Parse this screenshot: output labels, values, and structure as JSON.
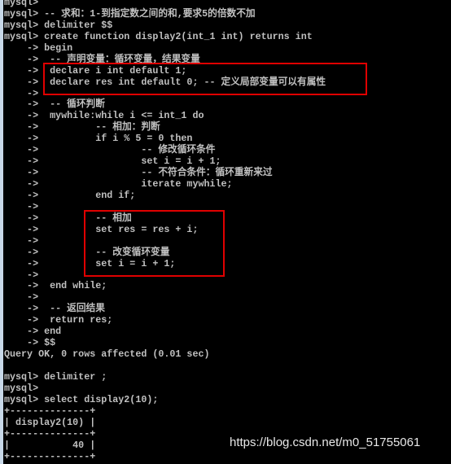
{
  "terminal": {
    "lines": [
      "mysql>",
      "mysql> -- 求和：1-到指定数之间的和,要求5的倍数不加",
      "mysql> delimiter $$",
      "mysql> create function display2(int_1 int) returns int",
      "    -> begin",
      "    ->  -- 声明变量：循环变量，结果变量",
      "    ->  declare i int default 1;",
      "    ->  declare res int default 0; -- 定义局部变量可以有属性",
      "    ->",
      "    ->  -- 循环判断",
      "    ->  mywhile:while i <= int_1 do",
      "    ->          -- 相加：判断",
      "    ->          if i % 5 = 0 then",
      "    ->                  -- 修改循环条件",
      "    ->                  set i = i + 1;",
      "    ->                  -- 不符合条件：循环重新来过",
      "    ->                  iterate mywhile;",
      "    ->          end if;",
      "    ->",
      "    ->          -- 相加",
      "    ->          set res = res + i;",
      "    ->",
      "    ->          -- 改变循环变量",
      "    ->          set i = i + 1;",
      "    ->",
      "    ->  end while;",
      "    ->",
      "    ->  -- 返回结果",
      "    ->  return res;",
      "    -> end",
      "    -> $$",
      "Query OK, 0 rows affected (0.01 sec)",
      "",
      "mysql> delimiter ;",
      "mysql>",
      "mysql> select display2(10);",
      "+--------------+",
      "| display2(10) |",
      "+--------------+",
      "|           40 |",
      "+--------------+"
    ]
  },
  "watermark": "https://blog.csdn.net/m0_51755061",
  "colors": {
    "highlight_box": "#e00000",
    "text": "#c0c0c0",
    "background": "#000000"
  }
}
